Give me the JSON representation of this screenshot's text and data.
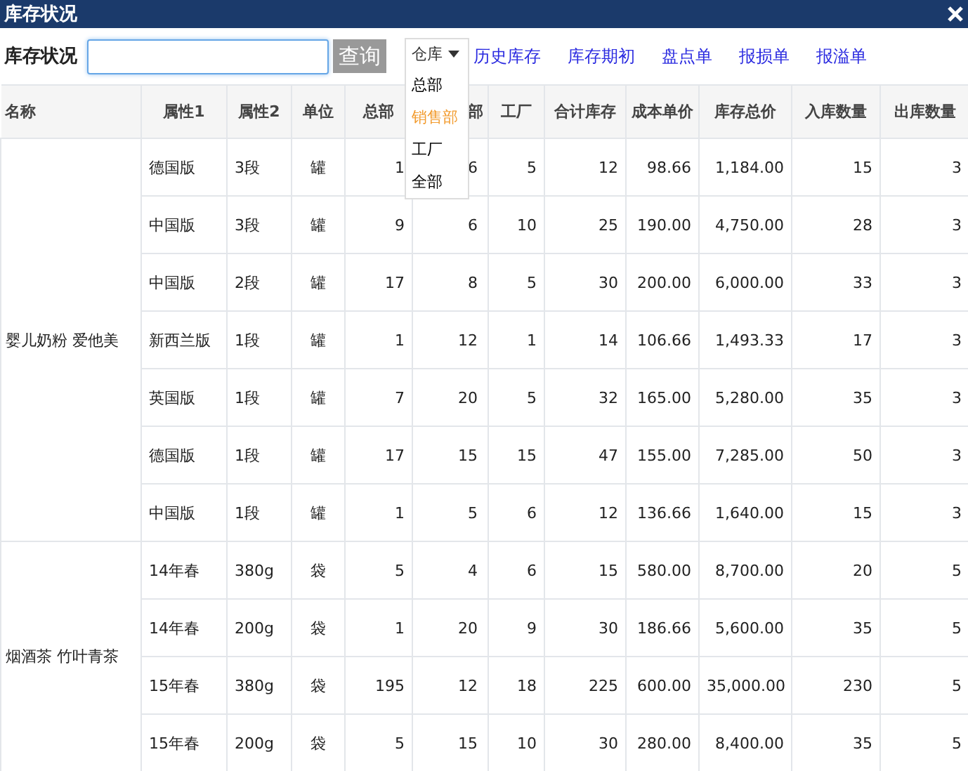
{
  "window": {
    "title": "库存状况"
  },
  "toolbar": {
    "label": "库存状况",
    "search_field": {
      "focused": true
    },
    "query_button": "查询",
    "warehouse_menu": {
      "label": "仓库",
      "options": [
        {
          "label": "总部",
          "selected": false
        },
        {
          "label": "销售部",
          "selected": true
        },
        {
          "label": "工厂",
          "selected": false
        },
        {
          "label": "全部",
          "selected": false
        }
      ]
    },
    "links": [
      "历史库存",
      "库存期初",
      "盘点单",
      "报损单",
      "报溢单"
    ]
  },
  "table": {
    "columns": [
      "名称",
      "属性1",
      "属性2",
      "单位",
      "总部",
      "部",
      "工厂",
      "合计库存",
      "成本单价",
      "库存总价",
      "入库数量",
      "出库数量"
    ],
    "groups": [
      {
        "name": "婴儿奶粉 爱他美",
        "rows": [
          [
            "德国版",
            "3段",
            "罐",
            "1",
            "6",
            "5",
            "12",
            "98.66",
            "1,184.00",
            "15",
            "3"
          ],
          [
            "中国版",
            "3段",
            "罐",
            "9",
            "6",
            "10",
            "25",
            "190.00",
            "4,750.00",
            "28",
            "3"
          ],
          [
            "中国版",
            "2段",
            "罐",
            "17",
            "8",
            "5",
            "30",
            "200.00",
            "6,000.00",
            "33",
            "3"
          ],
          [
            "新西兰版",
            "1段",
            "罐",
            "1",
            "12",
            "1",
            "14",
            "106.66",
            "1,493.33",
            "17",
            "3"
          ],
          [
            "英国版",
            "1段",
            "罐",
            "7",
            "20",
            "5",
            "32",
            "165.00",
            "5,280.00",
            "35",
            "3"
          ],
          [
            "德国版",
            "1段",
            "罐",
            "17",
            "15",
            "15",
            "47",
            "155.00",
            "7,285.00",
            "50",
            "3"
          ],
          [
            "中国版",
            "1段",
            "罐",
            "1",
            "5",
            "6",
            "12",
            "136.66",
            "1,640.00",
            "15",
            "3"
          ]
        ]
      },
      {
        "name": "烟酒茶 竹叶青茶",
        "rows": [
          [
            "14年春",
            "380g",
            "袋",
            "5",
            "4",
            "6",
            "15",
            "580.00",
            "8,700.00",
            "20",
            "5"
          ],
          [
            "14年春",
            "200g",
            "袋",
            "1",
            "20",
            "9",
            "30",
            "186.66",
            "5,600.00",
            "35",
            "5"
          ],
          [
            "15年春",
            "380g",
            "袋",
            "195",
            "12",
            "18",
            "225",
            "600.00",
            "35,000.00",
            "230",
            "5"
          ],
          [
            "15年春",
            "200g",
            "袋",
            "5",
            "15",
            "10",
            "30",
            "280.00",
            "8,400.00",
            "35",
            "5"
          ]
        ]
      }
    ]
  }
}
